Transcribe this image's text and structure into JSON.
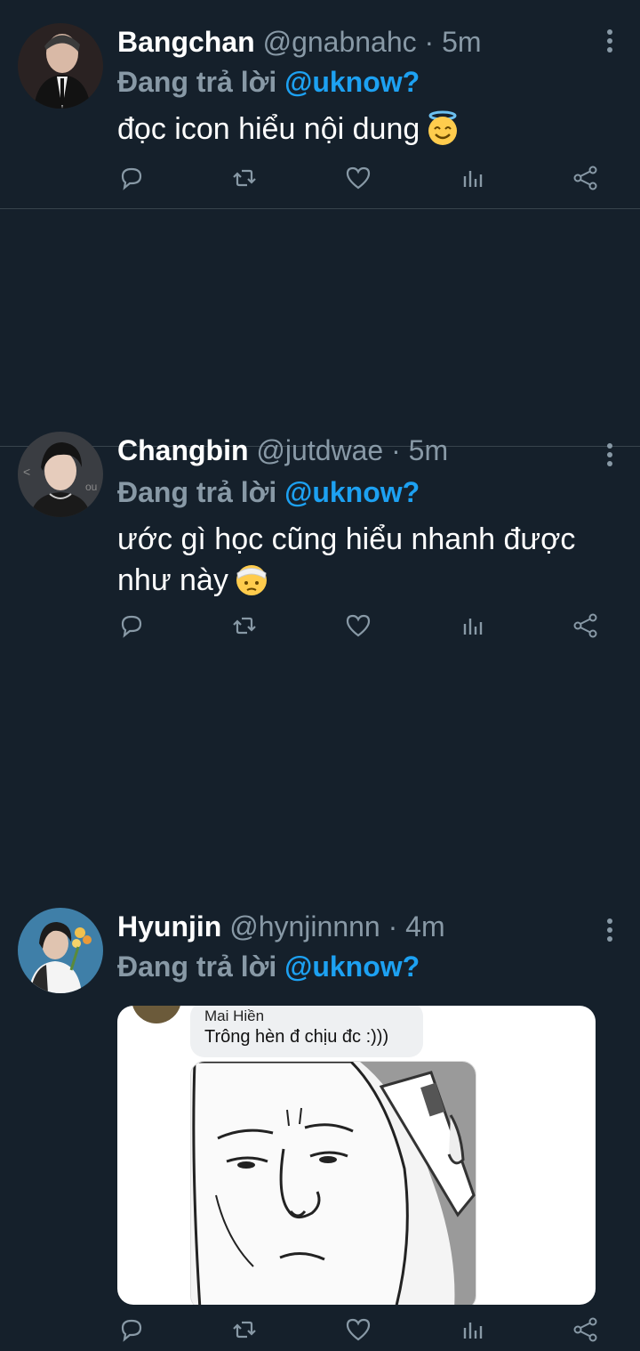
{
  "tweets": [
    {
      "name": "Bangchan",
      "handle": "@gnabnahc",
      "sep": "·",
      "time": "5m",
      "reply_prefix": "Đang trả lời",
      "reply_to": "@uknow?",
      "text": "đọc icon hiểu nội dung",
      "emoji": "smiling-face-with-halo"
    },
    {
      "name": "Changbin",
      "handle": "@jutdwae",
      "sep": "·",
      "time": "5m",
      "reply_prefix": "Đang trả lời",
      "reply_to": "@uknow?",
      "text": "ước gì học cũng hiểu nhanh được như này",
      "emoji": "face-with-head-bandage"
    },
    {
      "name": "Hyunjin",
      "handle": "@hynjinnnn",
      "sep": "·",
      "time": "4m",
      "reply_prefix": "Đang trả lời",
      "reply_to": "@uknow?",
      "media": {
        "chat_name": "Mai Hiền",
        "chat_message": "Trông hèn đ chịu đc :)))"
      }
    }
  ],
  "icons": {
    "reply": "reply-icon",
    "retweet": "retweet-icon",
    "like": "heart-icon",
    "stats": "stats-icon",
    "share": "share-icon",
    "more": "more-vertical-icon"
  },
  "colors": {
    "background": "#15202b",
    "muted": "#8899a6",
    "accent": "#1da1f2",
    "divider": "#38444d"
  }
}
